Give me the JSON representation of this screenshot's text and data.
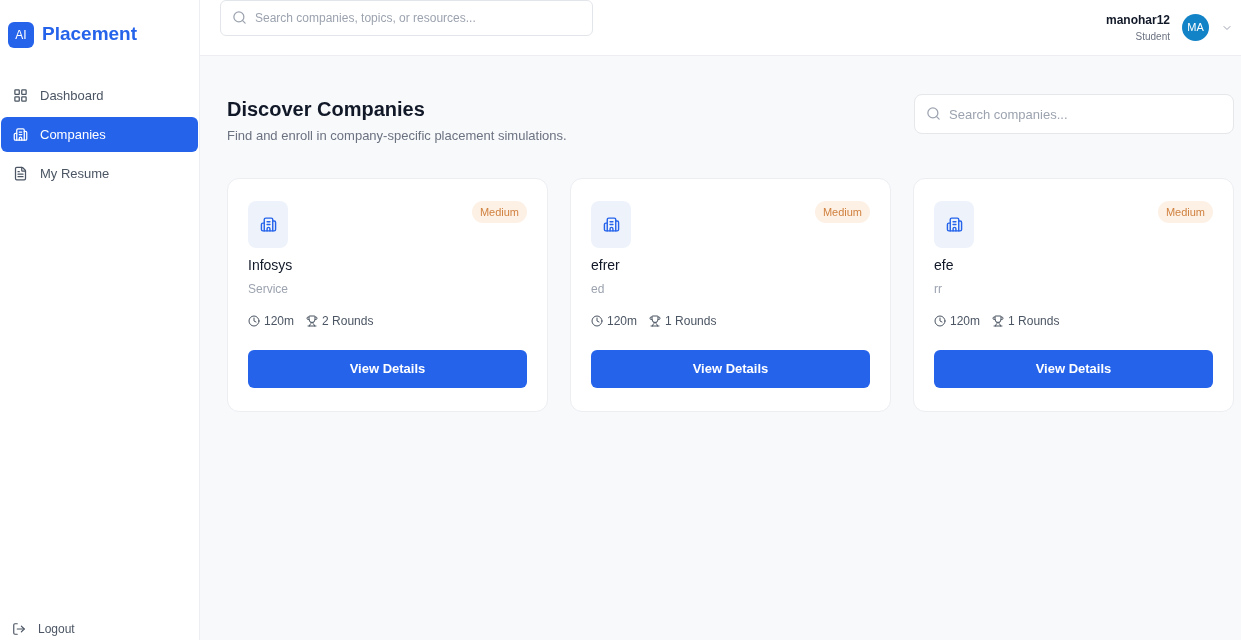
{
  "brand": {
    "logo": "AI",
    "name": "Placement"
  },
  "sidebar": {
    "items": [
      {
        "label": "Dashboard",
        "selected": false
      },
      {
        "label": "Companies",
        "selected": true
      },
      {
        "label": "My Resume",
        "selected": false
      }
    ],
    "logout": "Logout"
  },
  "header": {
    "search_placeholder": "Search companies, topics, or resources...",
    "user": {
      "name": "manohar12",
      "role": "Student",
      "initials": "MA"
    }
  },
  "page": {
    "title": "Discover Companies",
    "subtitle": "Find and enroll in company-specific placement simulations.",
    "search_placeholder": "Search companies..."
  },
  "companies": [
    {
      "name": "Infosys",
      "type": "Service",
      "difficulty": "Medium",
      "duration": "120m",
      "rounds": "2 Rounds",
      "action": "View Details"
    },
    {
      "name": "efrer",
      "type": "ed",
      "difficulty": "Medium",
      "duration": "120m",
      "rounds": "1 Rounds",
      "action": "View Details"
    },
    {
      "name": "efe",
      "type": "rr",
      "difficulty": "Medium",
      "duration": "120m",
      "rounds": "1 Rounds",
      "action": "View Details"
    }
  ]
}
